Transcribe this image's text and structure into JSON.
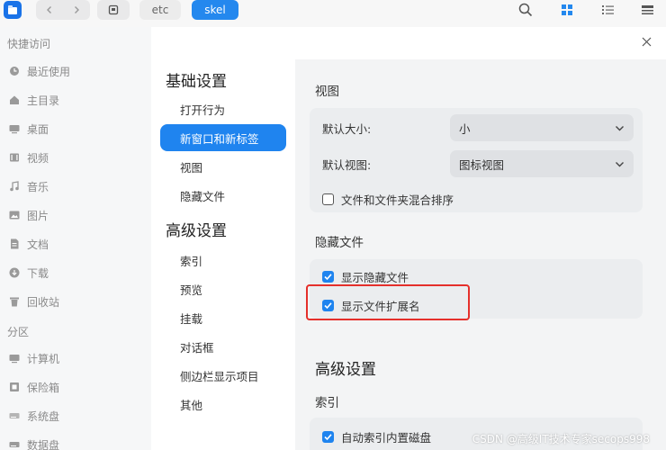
{
  "toolbar": {
    "breadcrumbs": [
      "etc",
      "skel"
    ],
    "icons": [
      "app-icon",
      "back-icon",
      "forward-icon",
      "drive-icon",
      "search-icon",
      "grid-view-icon",
      "list-view-icon",
      "menu-icon"
    ],
    "accent": "#2488ee"
  },
  "sidebar": {
    "section_quick": "快捷访问",
    "quick_items": [
      {
        "label": "最近使用",
        "icon": "clock-icon"
      },
      {
        "label": "主目录",
        "icon": "home-icon"
      },
      {
        "label": "桌面",
        "icon": "desktop-icon"
      },
      {
        "label": "视频",
        "icon": "video-icon"
      },
      {
        "label": "音乐",
        "icon": "music-icon"
      },
      {
        "label": "图片",
        "icon": "picture-icon"
      },
      {
        "label": "文档",
        "icon": "document-icon"
      },
      {
        "label": "下载",
        "icon": "download-icon"
      },
      {
        "label": "回收站",
        "icon": "trash-icon"
      }
    ],
    "section_partition": "分区",
    "partition_items": [
      {
        "label": "计算机",
        "icon": "computer-icon"
      },
      {
        "label": "保险箱",
        "icon": "safe-icon"
      },
      {
        "label": "系统盘",
        "icon": "disk-icon"
      },
      {
        "label": "数据盘",
        "icon": "disk-icon"
      }
    ]
  },
  "dialog": {
    "nav": {
      "basic_heading": "基础设置",
      "basic_items": [
        "打开行为",
        "新窗口和新标签",
        "视图",
        "隐藏文件"
      ],
      "active_item": "新窗口和新标签",
      "advanced_heading": "高级设置",
      "advanced_items": [
        "索引",
        "预览",
        "挂载",
        "对话框",
        "侧边栏显示项目",
        "其他"
      ]
    },
    "content": {
      "view_title": "视图",
      "default_size_label": "默认大小:",
      "default_size_value": "小",
      "default_view_label": "默认视图:",
      "default_view_value": "图标视图",
      "mixed_sort_label": "文件和文件夹混合排序",
      "mixed_sort_checked": false,
      "hidden_title": "隐藏文件",
      "show_hidden_label": "显示隐藏文件",
      "show_hidden_checked": true,
      "show_ext_label": "显示文件扩展名",
      "show_ext_checked": true,
      "advanced_title": "高级设置",
      "index_title": "索引",
      "auto_index_label": "自动索引内置磁盘",
      "auto_index_checked": true
    }
  },
  "watermark": "CSDN @高级IT技术专家secops998"
}
